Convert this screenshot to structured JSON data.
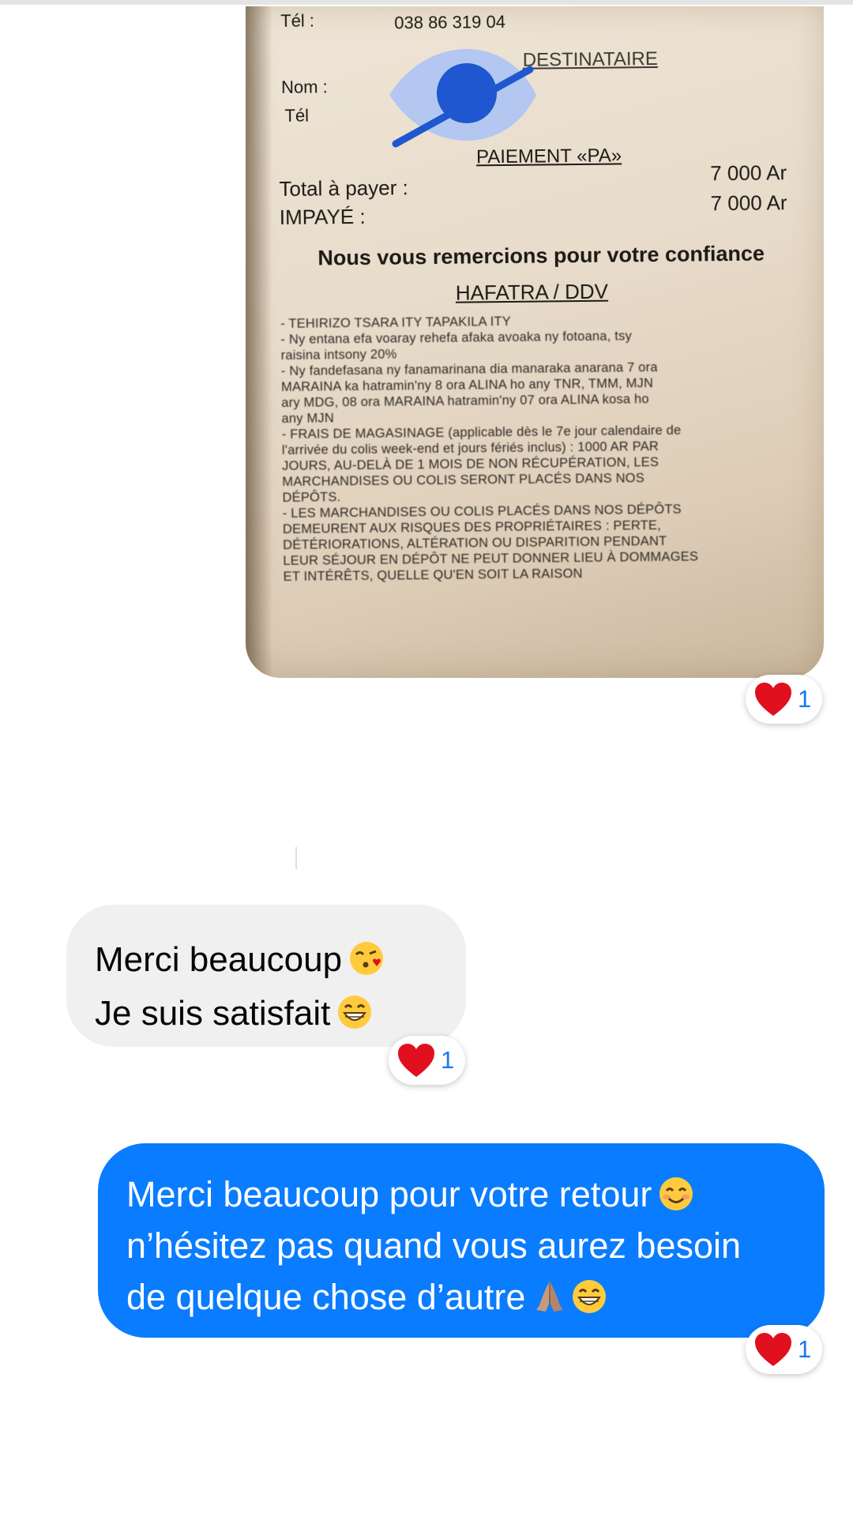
{
  "receipt": {
    "tel_label": "Tél :",
    "tel_value": "038 86 319 04",
    "recipient_heading": "DESTINATAIRE",
    "nom_label": "Nom :",
    "tel2_label": "Tél",
    "payment_heading": "PAIEMENT «PA»",
    "total_label": "Total à payer :",
    "total_value": "7 000 Ar",
    "impaye_label": "IMPAYÉ :",
    "impaye_value": "7 000 Ar",
    "thanks": "Nous vous remercions pour votre confiance",
    "brand": "HAFATRA / DDV",
    "fine_print": [
      "- TEHIRIZO TSARA ITY TAPAKILA ITY",
      "- Ny entana efa voaray rehefa afaka avoaka ny fotoana, tsy",
      "raisina intsony 20%",
      "- Ny fandefasana ny fanamarinana dia manaraka anarana 7 ora",
      "MARAINA ka hatramin'ny 8 ora ALINA ho any TNR, TMM, MJN",
      "ary MDG, 08 ora MARAINA hatramin'ny 07 ora ALINA kosa ho",
      "any MJN",
      "- FRAIS DE MAGASINAGE (applicable dès le 7e jour calendaire de",
      "l'arrivée du colis week-end et jours fériés inclus) : 1000 AR PAR",
      "JOURS, AU-DELÀ DE 1 MOIS DE NON RÉCUPÉRATION, LES",
      "MARCHANDISES OU COLIS SERONT PLACÉS DANS NOS",
      "DÉPÔTS.",
      "- LES MARCHANDISES OU COLIS PLACÉS DANS NOS DÉPÔTS",
      "DEMEURENT AUX RISQUES DES PROPRIÉTAIRES : PERTE,",
      "DÉTÉRIORATIONS, ALTÉRATION OU DISPARITION PENDANT",
      "LEUR SÉJOUR EN DÉPÔT NE PEUT DONNER LIEU À DOMMAGES",
      "ET INTÉRÊTS, QUELLE QU'EN SOIT LA RAISON"
    ]
  },
  "reactions": {
    "photo": {
      "emoji": "heart",
      "count": "1"
    },
    "incoming": {
      "emoji": "heart",
      "count": "1"
    },
    "outgoing": {
      "emoji": "heart",
      "count": "1"
    }
  },
  "messages": {
    "incoming": {
      "line1": "Merci beaucoup",
      "line1_emoji": "kissing-face-emoji",
      "line2": "Je suis satisfait",
      "line2_emoji": "grinning-face-emoji"
    },
    "outgoing": {
      "line1": "Merci beaucoup pour votre retour",
      "line1_emoji": "smiling-face-emoji",
      "line2": "n’hésitez pas quand vous aurez besoin",
      "line3": "de quelque chose d’autre",
      "line3_emojis": [
        "folded-hands-emoji",
        "grinning-face-emoji"
      ]
    }
  },
  "colors": {
    "outgoing_bubble": "#0a7cff",
    "incoming_bubble": "#f0f0f0",
    "reaction_count": "#1877f2",
    "heart": "#e0101e",
    "hidden_icon_light": "#b3c7f0",
    "hidden_icon_dark": "#1f57d0"
  }
}
